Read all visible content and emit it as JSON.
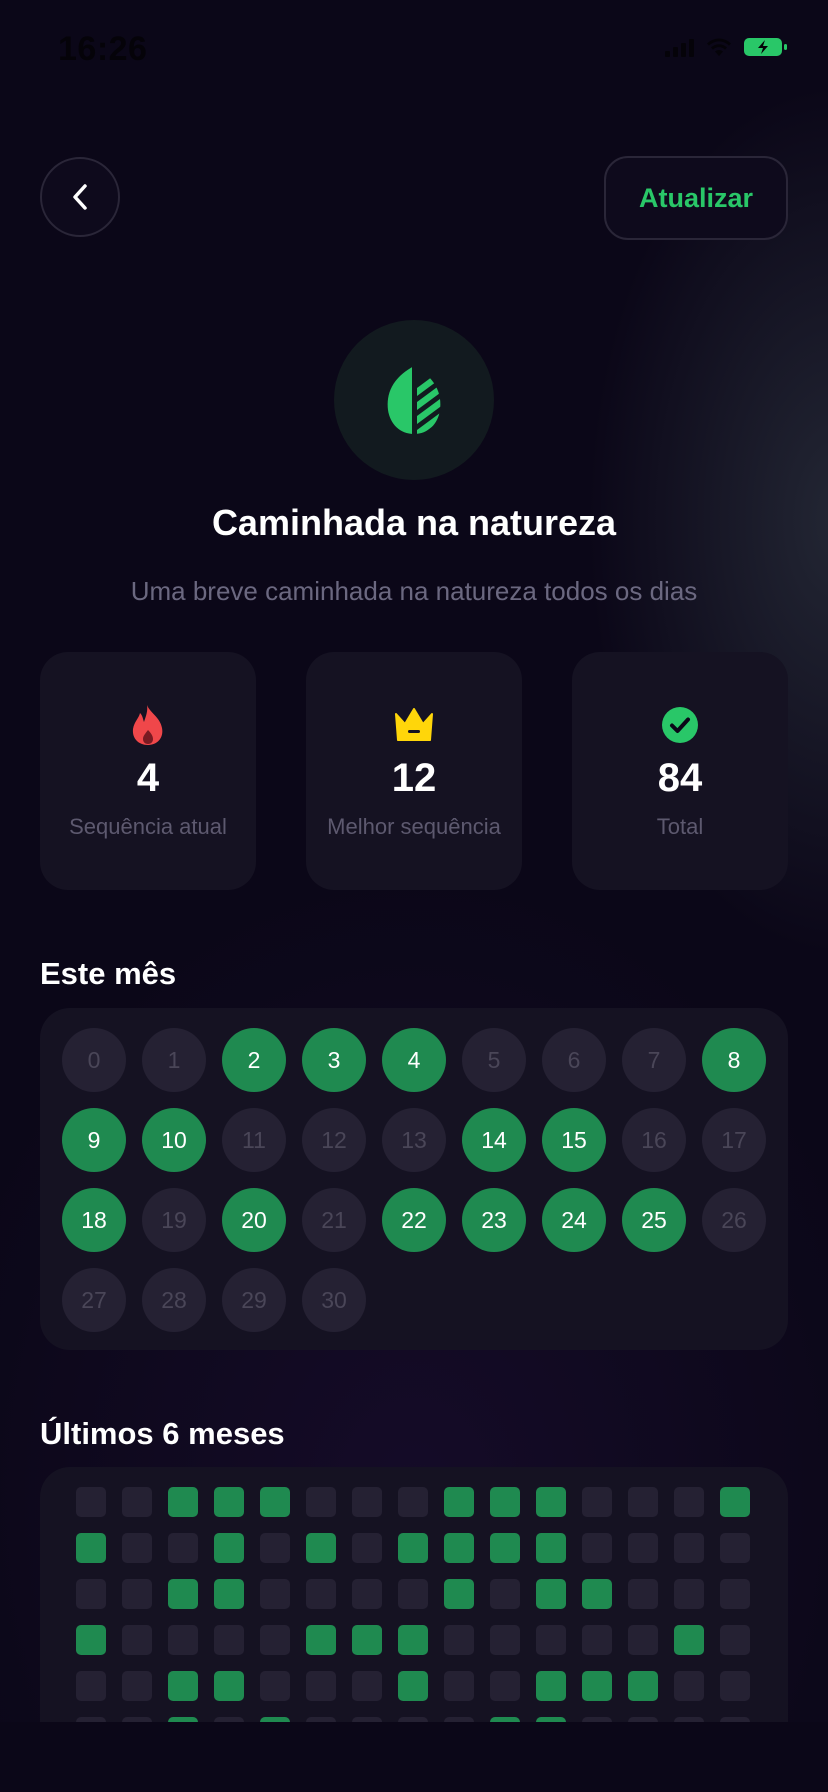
{
  "status_bar": {
    "time": "16:26"
  },
  "header": {
    "refresh_label": "Atualizar"
  },
  "habit": {
    "title": "Caminhada na natureza",
    "description": "Uma breve caminhada na natureza todos os dias"
  },
  "stats": [
    {
      "icon": "fire-icon",
      "value": "4",
      "label": "Sequência atual"
    },
    {
      "icon": "crown-icon",
      "value": "12",
      "label": "Melhor sequência"
    },
    {
      "icon": "check-circle-icon",
      "value": "84",
      "label": "Total"
    }
  ],
  "month": {
    "title": "Este mês",
    "days": [
      {
        "label": "0",
        "done": false
      },
      {
        "label": "1",
        "done": false
      },
      {
        "label": "2",
        "done": true
      },
      {
        "label": "3",
        "done": true
      },
      {
        "label": "4",
        "done": true
      },
      {
        "label": "5",
        "done": false
      },
      {
        "label": "6",
        "done": false
      },
      {
        "label": "7",
        "done": false
      },
      {
        "label": "8",
        "done": true
      },
      {
        "label": "9",
        "done": true
      },
      {
        "label": "10",
        "done": true
      },
      {
        "label": "11",
        "done": false
      },
      {
        "label": "12",
        "done": false
      },
      {
        "label": "13",
        "done": false
      },
      {
        "label": "14",
        "done": true
      },
      {
        "label": "15",
        "done": true
      },
      {
        "label": "16",
        "done": false
      },
      {
        "label": "17",
        "done": false
      },
      {
        "label": "18",
        "done": true
      },
      {
        "label": "19",
        "done": false
      },
      {
        "label": "20",
        "done": true
      },
      {
        "label": "21",
        "done": false
      },
      {
        "label": "22",
        "done": true
      },
      {
        "label": "23",
        "done": true
      },
      {
        "label": "24",
        "done": true
      },
      {
        "label": "25",
        "done": true
      },
      {
        "label": "26",
        "done": false
      },
      {
        "label": "27",
        "done": false
      },
      {
        "label": "28",
        "done": false
      },
      {
        "label": "29",
        "done": false
      },
      {
        "label": "30",
        "done": false
      }
    ]
  },
  "six_months": {
    "title": "Últimos 6 meses",
    "rows": [
      [
        0,
        0,
        1,
        1,
        1,
        0,
        0,
        0,
        1,
        1,
        1,
        0,
        0,
        0,
        1
      ],
      [
        1,
        0,
        0,
        1,
        0,
        1,
        0,
        1,
        1,
        1,
        1,
        0,
        0,
        0,
        0
      ],
      [
        0,
        0,
        1,
        1,
        0,
        0,
        0,
        0,
        1,
        0,
        1,
        1,
        0,
        0,
        0
      ],
      [
        1,
        0,
        0,
        0,
        0,
        1,
        1,
        1,
        0,
        0,
        0,
        0,
        0,
        1,
        0
      ],
      [
        0,
        0,
        1,
        1,
        0,
        0,
        0,
        1,
        0,
        0,
        1,
        1,
        1,
        0,
        0
      ],
      [
        0,
        0,
        1,
        0,
        1,
        0,
        0,
        0,
        0,
        1,
        1,
        0,
        0,
        0,
        0
      ]
    ]
  },
  "colors": {
    "background": "#0b0718",
    "card": "#151222",
    "accent_green": "#29c768",
    "done_green": "#1f8a50",
    "empty_cell": "#252133",
    "fire": "#f0474a",
    "crown": "#ffd60a"
  }
}
